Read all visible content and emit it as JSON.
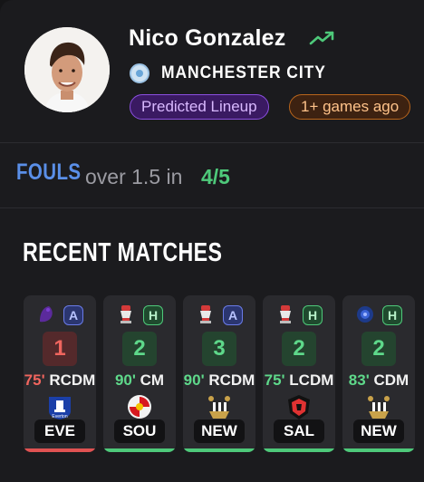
{
  "player": {
    "name": "Nico Gonzalez",
    "trend_icon": "trending-up-icon",
    "club": "MANCHESTER CITY",
    "badges": {
      "predicted": "Predicted Lineup",
      "games": "1+ games ago"
    }
  },
  "stat": {
    "label": "FOULS",
    "text": "over 1.5 in",
    "value": "4/5"
  },
  "section_title": "RECENT MATCHES",
  "colors": {
    "win": "#4ec97a",
    "loss": "#e05252",
    "accent_blue": "#5a8fe8"
  },
  "matches": [
    {
      "competition_icon": "premier-league-icon",
      "venue": "A",
      "venue_type": "away",
      "score": "1",
      "result": "loss",
      "minutes": "75'",
      "position": "RCDM",
      "opponent": "EVE",
      "crest_icon": "everton-crest-icon"
    },
    {
      "competition_icon": "fa-cup-icon",
      "venue": "H",
      "venue_type": "home",
      "score": "2",
      "result": "win",
      "minutes": "90'",
      "position": "CM",
      "opponent": "SOU",
      "crest_icon": "southampton-crest-icon"
    },
    {
      "competition_icon": "fa-cup-icon",
      "venue": "A",
      "venue_type": "away",
      "score": "3",
      "result": "win",
      "minutes": "90'",
      "position": "RCDM",
      "opponent": "NEW",
      "crest_icon": "newcastle-crest-icon"
    },
    {
      "competition_icon": "fa-cup-icon",
      "venue": "H",
      "venue_type": "home",
      "score": "2",
      "result": "win",
      "minutes": "75'",
      "position": "LCDM",
      "opponent": "SAL",
      "crest_icon": "salford-crest-icon"
    },
    {
      "competition_icon": "league-cup-icon",
      "venue": "H",
      "venue_type": "home",
      "score": "2",
      "result": "win",
      "minutes": "83'",
      "position": "CDM",
      "opponent": "NEW",
      "crest_icon": "newcastle-crest-icon"
    }
  ]
}
